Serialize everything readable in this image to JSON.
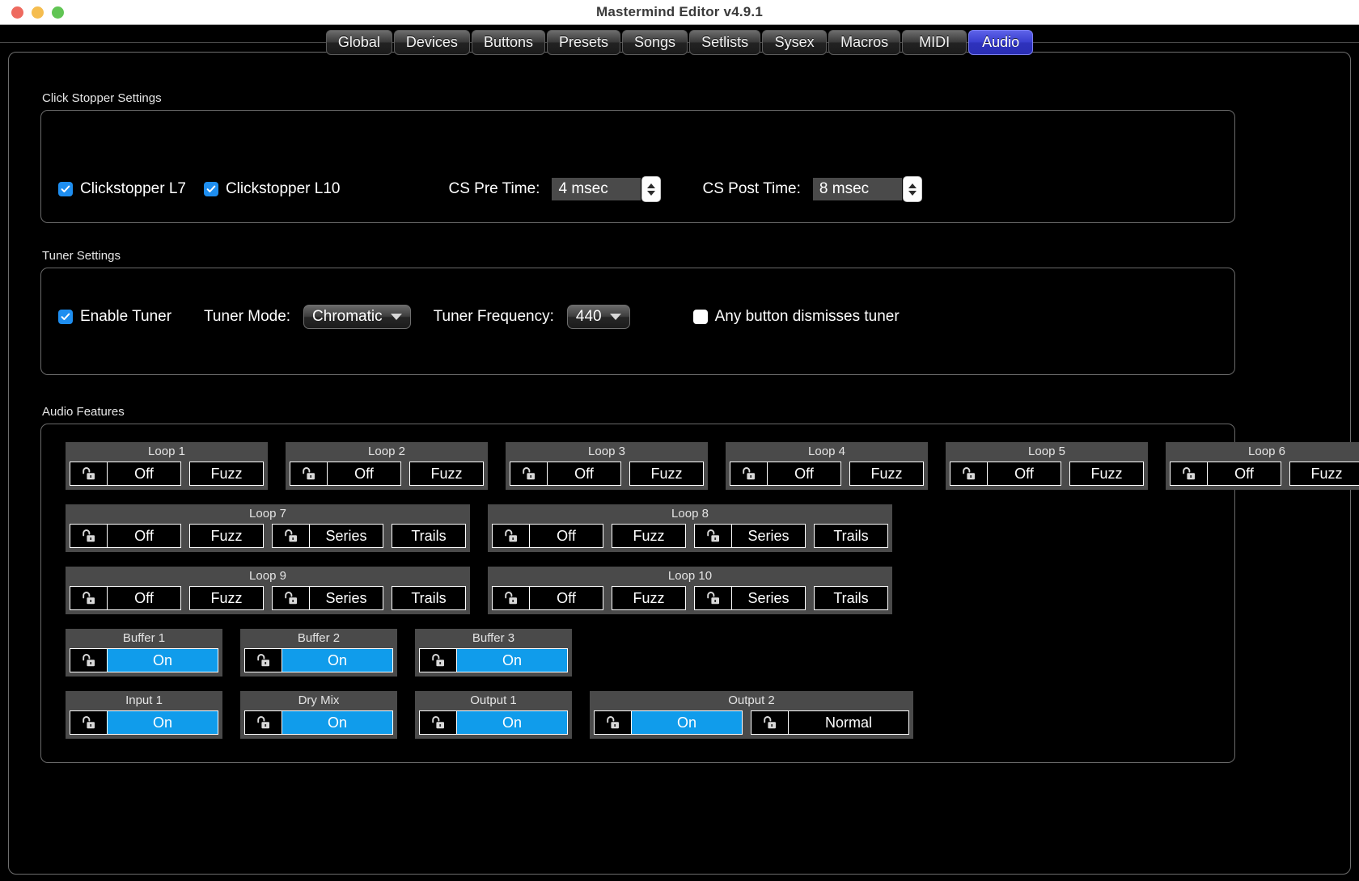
{
  "window": {
    "title": "Mastermind Editor v4.9.1",
    "controls": [
      "close",
      "minimize",
      "zoom"
    ]
  },
  "tabs": [
    {
      "label": "Global",
      "active": false
    },
    {
      "label": "Devices",
      "active": false
    },
    {
      "label": "Buttons",
      "active": false
    },
    {
      "label": "Presets",
      "active": false
    },
    {
      "label": "Songs",
      "active": false
    },
    {
      "label": "Setlists",
      "active": false
    },
    {
      "label": "Sysex",
      "active": false
    },
    {
      "label": "Macros",
      "active": false
    },
    {
      "label": "MIDI",
      "active": false
    },
    {
      "label": "Audio",
      "active": true
    }
  ],
  "accent": {
    "tab_active": "#3a3fd0",
    "checkbox_on": "#1e8ef0",
    "button_on": "#109ceb",
    "panel_bg": "#4a4a4a"
  },
  "click_stopper": {
    "label": "Click Stopper Settings",
    "clickstopper_l7": {
      "label": "Clickstopper L7",
      "checked": true
    },
    "clickstopper_l10": {
      "label": "Clickstopper L10",
      "checked": true
    },
    "cs_pre_time": {
      "label": "CS Pre Time:",
      "value": "4 msec"
    },
    "cs_post_time": {
      "label": "CS Post Time:",
      "value": "8 msec"
    }
  },
  "tuner": {
    "label": "Tuner Settings",
    "enable_tuner": {
      "label": "Enable Tuner",
      "checked": true
    },
    "tuner_mode": {
      "label": "Tuner Mode:",
      "value": "Chromatic"
    },
    "tuner_frequency": {
      "label": "Tuner Frequency:",
      "value": "440"
    },
    "any_button_dismisses": {
      "label": "Any button dismisses tuner",
      "checked": false
    }
  },
  "audio_features": {
    "label": "Audio Features",
    "lock_icon": "unlocked-padlock-icon",
    "rows": [
      {
        "panels": [
          {
            "title": "Loop 1",
            "groups": [
              {
                "lock": true,
                "label": "Off",
                "state": "off",
                "width": "w-off"
              },
              {
                "lock": false,
                "label": "Fuzz",
                "state": "off",
                "width": "w-fuzz"
              }
            ]
          },
          {
            "title": "Loop 2",
            "groups": [
              {
                "lock": true,
                "label": "Off",
                "state": "off",
                "width": "w-off"
              },
              {
                "lock": false,
                "label": "Fuzz",
                "state": "off",
                "width": "w-fuzz"
              }
            ]
          },
          {
            "title": "Loop 3",
            "groups": [
              {
                "lock": true,
                "label": "Off",
                "state": "off",
                "width": "w-off"
              },
              {
                "lock": false,
                "label": "Fuzz",
                "state": "off",
                "width": "w-fuzz"
              }
            ]
          },
          {
            "title": "Loop 4",
            "groups": [
              {
                "lock": true,
                "label": "Off",
                "state": "off",
                "width": "w-off"
              },
              {
                "lock": false,
                "label": "Fuzz",
                "state": "off",
                "width": "w-fuzz"
              }
            ]
          },
          {
            "title": "Loop 5",
            "groups": [
              {
                "lock": true,
                "label": "Off",
                "state": "off",
                "width": "w-off"
              },
              {
                "lock": false,
                "label": "Fuzz",
                "state": "off",
                "width": "w-fuzz"
              }
            ]
          },
          {
            "title": "Loop 6",
            "groups": [
              {
                "lock": true,
                "label": "Off",
                "state": "off",
                "width": "w-off"
              },
              {
                "lock": false,
                "label": "Fuzz",
                "state": "off",
                "width": "w-fuzz"
              }
            ]
          }
        ]
      },
      {
        "panels": [
          {
            "title": "Loop 7",
            "groups": [
              {
                "lock": true,
                "label": "Off",
                "state": "off",
                "width": "w-off"
              },
              {
                "lock": false,
                "label": "Fuzz",
                "state": "off",
                "width": "w-fuzz"
              },
              {
                "lock": true,
                "label": "Series",
                "state": "off",
                "width": "w-series"
              },
              {
                "lock": false,
                "label": "Trails",
                "state": "off",
                "width": "w-trails"
              }
            ]
          },
          {
            "title": "Loop 8",
            "groups": [
              {
                "lock": true,
                "label": "Off",
                "state": "off",
                "width": "w-off"
              },
              {
                "lock": false,
                "label": "Fuzz",
                "state": "off",
                "width": "w-fuzz"
              },
              {
                "lock": true,
                "label": "Series",
                "state": "off",
                "width": "w-series"
              },
              {
                "lock": false,
                "label": "Trails",
                "state": "off",
                "width": "w-trails"
              }
            ]
          }
        ]
      },
      {
        "panels": [
          {
            "title": "Loop 9",
            "groups": [
              {
                "lock": true,
                "label": "Off",
                "state": "off",
                "width": "w-off"
              },
              {
                "lock": false,
                "label": "Fuzz",
                "state": "off",
                "width": "w-fuzz"
              },
              {
                "lock": true,
                "label": "Series",
                "state": "off",
                "width": "w-series"
              },
              {
                "lock": false,
                "label": "Trails",
                "state": "off",
                "width": "w-trails"
              }
            ]
          },
          {
            "title": "Loop 10",
            "groups": [
              {
                "lock": true,
                "label": "Off",
                "state": "off",
                "width": "w-off"
              },
              {
                "lock": false,
                "label": "Fuzz",
                "state": "off",
                "width": "w-fuzz"
              },
              {
                "lock": true,
                "label": "Series",
                "state": "off",
                "width": "w-series"
              },
              {
                "lock": false,
                "label": "Trails",
                "state": "off",
                "width": "w-trails"
              }
            ]
          }
        ]
      },
      {
        "panels": [
          {
            "title": "Buffer 1",
            "groups": [
              {
                "lock": true,
                "label": "On",
                "state": "on",
                "width": "w-on"
              }
            ]
          },
          {
            "title": "Buffer 2",
            "groups": [
              {
                "lock": true,
                "label": "On",
                "state": "on",
                "width": "w-on"
              }
            ]
          },
          {
            "title": "Buffer 3",
            "groups": [
              {
                "lock": true,
                "label": "On",
                "state": "on",
                "width": "w-on"
              }
            ]
          }
        ]
      },
      {
        "panels": [
          {
            "title": "Input 1",
            "groups": [
              {
                "lock": true,
                "label": "On",
                "state": "on",
                "width": "w-on"
              }
            ]
          },
          {
            "title": "Dry Mix",
            "groups": [
              {
                "lock": true,
                "label": "On",
                "state": "on",
                "width": "w-on"
              }
            ]
          },
          {
            "title": "Output 1",
            "groups": [
              {
                "lock": true,
                "label": "On",
                "state": "on",
                "width": "w-on"
              }
            ]
          },
          {
            "title": "Output 2",
            "groups": [
              {
                "lock": true,
                "label": "On",
                "state": "on",
                "width": "w-on"
              },
              {
                "lock": true,
                "label": "Normal",
                "state": "off",
                "width": "w-normal"
              }
            ]
          }
        ]
      }
    ]
  }
}
